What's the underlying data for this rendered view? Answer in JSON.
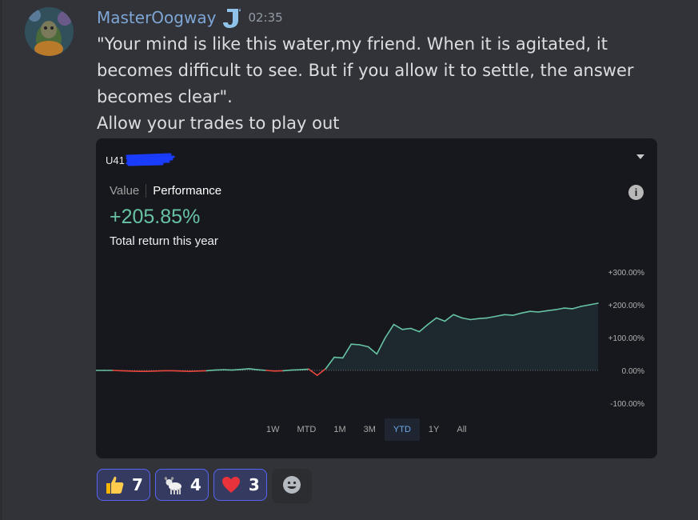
{
  "message": {
    "username": "MasterOogway",
    "timestamp": "02:35",
    "lines": [
      "\"Your mind is like this water,my friend. When it is agitated, it becomes difficult to see. But if you allow it to settle, the answer becomes clear\".",
      "Allow your trades to play out"
    ]
  },
  "embed": {
    "account_prefix": "U41",
    "tabs": [
      "Value",
      "Performance"
    ],
    "selected_tab": "Performance",
    "performance_value": "+205.85%",
    "performance_caption": "Total return this year",
    "ranges": [
      "1W",
      "MTD",
      "1M",
      "3M",
      "YTD",
      "1Y",
      "All"
    ],
    "selected_range": "YTD",
    "colors": {
      "gain": "#67c3a4",
      "loss": "#e8453c",
      "accent": "#6aa6e8"
    }
  },
  "chart_data": {
    "type": "line",
    "y_tick_labels": [
      "+300.00%",
      "+200.00%",
      "+100.00%",
      "0.00%",
      "-100.00%"
    ],
    "ylim": [
      -100,
      300
    ],
    "baseline": 0,
    "series": [
      {
        "values": [
          0,
          0,
          0,
          -1,
          -2,
          -3,
          -3,
          -2,
          -1,
          -1,
          -2,
          -3,
          -2,
          -1,
          1,
          2,
          1,
          3,
          5,
          2,
          0,
          -2,
          -1,
          1,
          2,
          4,
          -15,
          5,
          40,
          38,
          80,
          78,
          72,
          50,
          100,
          140,
          125,
          128,
          118,
          140,
          160,
          150,
          170,
          160,
          155,
          158,
          160,
          165,
          170,
          168,
          175,
          180,
          178,
          182,
          185,
          190,
          188,
          195,
          200,
          205
        ]
      }
    ]
  },
  "reactions": [
    {
      "icon": "thumbs-up-icon",
      "count": "7"
    },
    {
      "icon": "goat-icon",
      "count": "4"
    },
    {
      "icon": "heart-icon",
      "count": "3"
    }
  ]
}
